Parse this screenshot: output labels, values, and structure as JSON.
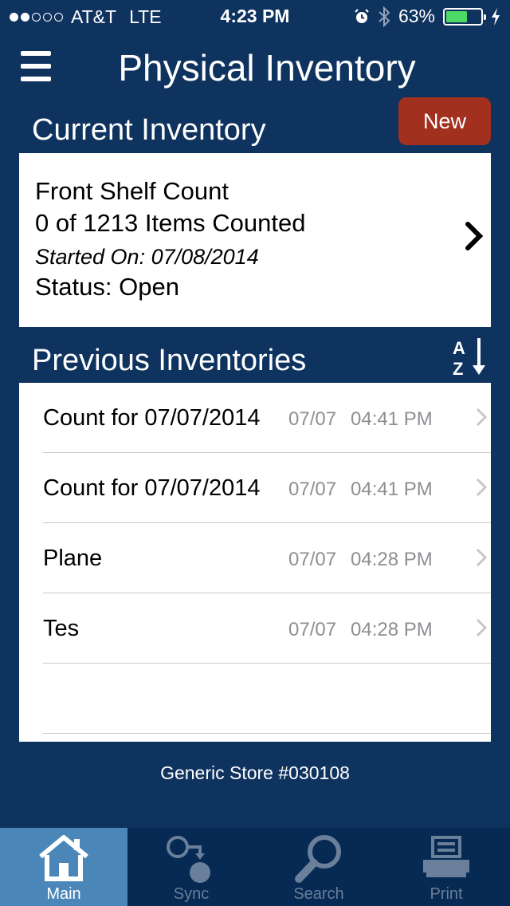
{
  "status_bar": {
    "carrier": "AT&T",
    "network": "LTE",
    "time": "4:23 PM",
    "battery": "63%",
    "battery_level": 0.63,
    "signal_bars": 2
  },
  "header": {
    "title": "Physical Inventory",
    "menu_icon": "hamburger-icon"
  },
  "current": {
    "section_title": "Current Inventory",
    "new_label": "New",
    "name": "Front Shelf Count",
    "progress": "0 of 1213 Items Counted",
    "started": "Started On: 07/08/2014",
    "status": "Status: Open"
  },
  "previous": {
    "section_title": "Previous Inventories",
    "sort_icon": "sort-az-icon",
    "items": [
      {
        "name": "Count for 07/07/2014",
        "date": "07/07",
        "time": "04:41 PM"
      },
      {
        "name": "Count for 07/07/2014",
        "date": "07/07",
        "time": "04:41 PM"
      },
      {
        "name": "Plane",
        "date": "07/07",
        "time": "04:28 PM"
      },
      {
        "name": "Tes",
        "date": "07/07",
        "time": "04:28 PM"
      }
    ]
  },
  "store": "Generic Store #030108",
  "tabs": [
    {
      "label": "Main",
      "icon": "home-icon",
      "active": true
    },
    {
      "label": "Sync",
      "icon": "sync-icon",
      "active": false
    },
    {
      "label": "Search",
      "icon": "search-icon",
      "active": false
    },
    {
      "label": "Print",
      "icon": "print-icon",
      "active": false
    }
  ],
  "colors": {
    "background": "#0f335f",
    "new_button": "#a2301f",
    "active_tab": "#4a86b8",
    "tab_bar": "#062a53",
    "battery": "#4cd964"
  }
}
